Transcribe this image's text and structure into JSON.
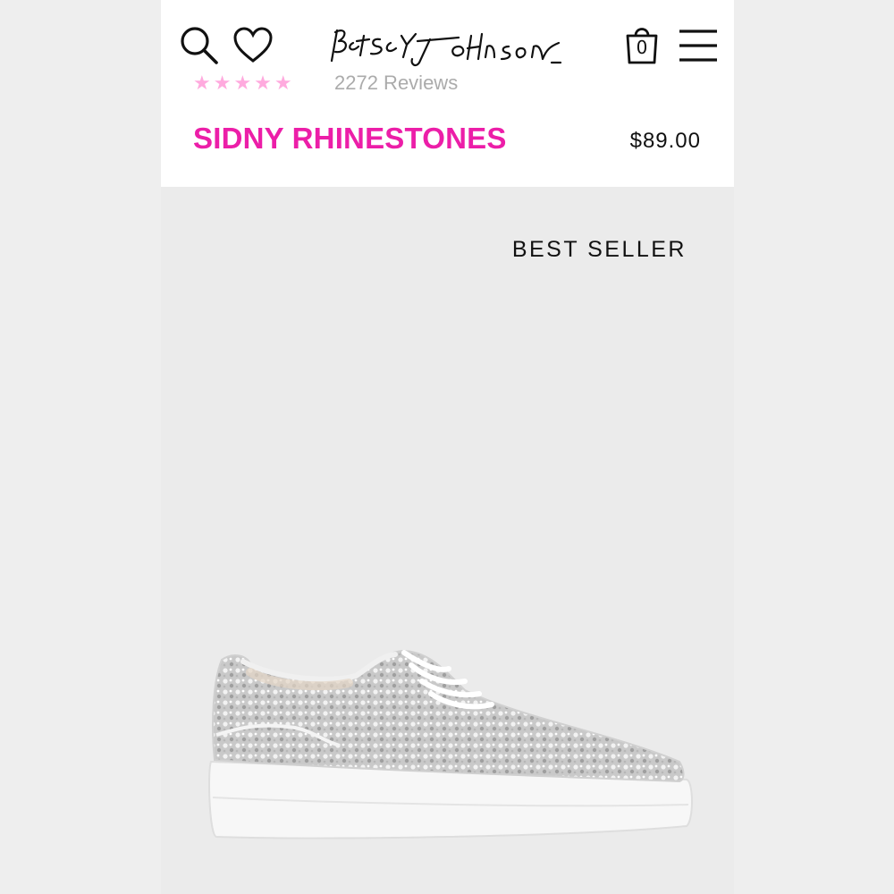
{
  "header": {
    "brand": "Betsey Johnson",
    "cart_count": "0",
    "icons": [
      "search-icon",
      "heart-icon",
      "bag-icon",
      "menu-icon"
    ]
  },
  "product": {
    "rating_stars": "★★★★★",
    "reviews_text": "2272 Reviews",
    "title": "SIDNY RHINESTONES",
    "price": "$89.00",
    "badge": "BEST SELLER"
  },
  "colors": {
    "brand_pink": "#ec1ea8",
    "text_dark": "#111111",
    "image_background": "#ebebeb"
  }
}
